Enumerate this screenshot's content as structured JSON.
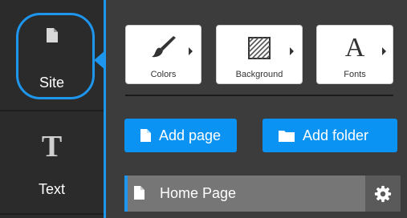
{
  "sidebar": {
    "items": [
      {
        "label": "Site",
        "icon": "page-icon",
        "active": true
      },
      {
        "label": "Text",
        "icon": "text-icon",
        "active": false
      }
    ]
  },
  "toolbar": {
    "tools": [
      {
        "label": "Colors",
        "icon": "paintbrush-icon"
      },
      {
        "label": "Background",
        "icon": "hatched-square-icon"
      },
      {
        "label": "Fonts",
        "icon": "letter-a-icon",
        "glyph": "A"
      }
    ]
  },
  "actions": {
    "add_page_label": "Add page",
    "add_folder_label": "Add folder"
  },
  "pages": [
    {
      "label": "Home Page",
      "icon": "page-icon",
      "settings_icon": "gear-icon"
    }
  ],
  "colors": {
    "accent": "#1e96ee",
    "button": "#0a93f2",
    "sidebar_bg": "#2b2b2b",
    "panel_bg": "#3c3c3c",
    "row_bg": "#767676"
  }
}
